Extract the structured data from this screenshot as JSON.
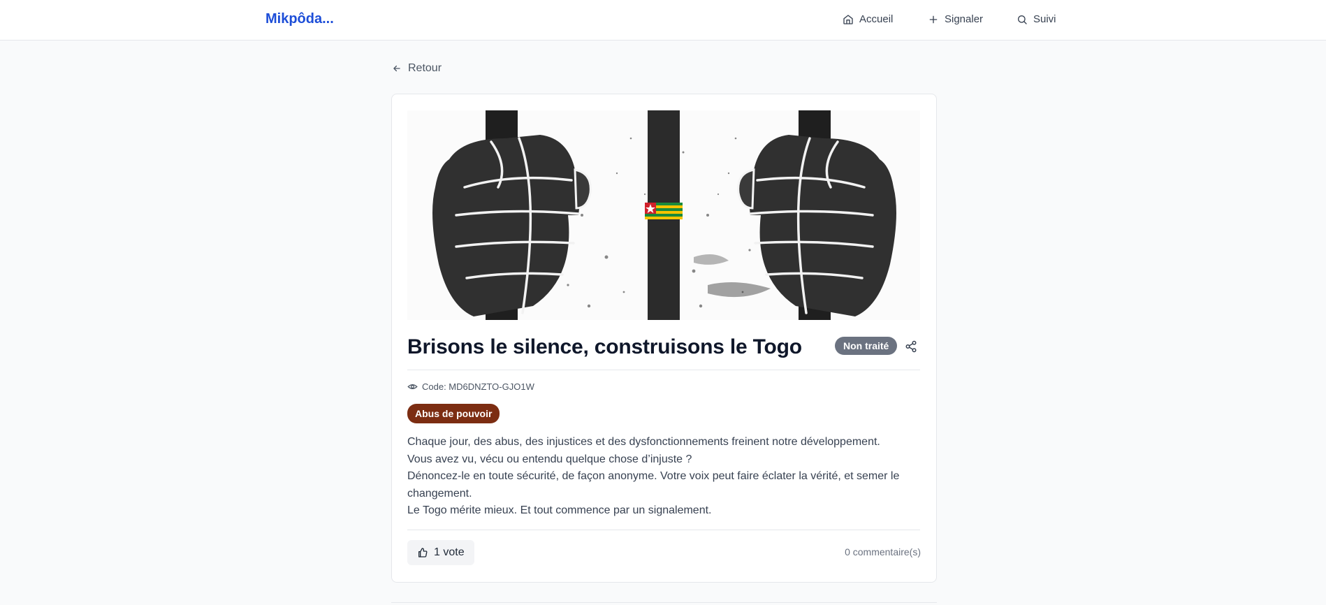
{
  "header": {
    "brand": "Mikpôda...",
    "nav": [
      {
        "label": "Accueil",
        "icon": "home-icon"
      },
      {
        "label": "Signaler",
        "icon": "plus-icon"
      },
      {
        "label": "Suivi",
        "icon": "search-icon"
      }
    ]
  },
  "back_label": "Retour",
  "report": {
    "image_alt": "Poings serrés sur des barreaux avec un drapeau du Togo",
    "title": "Brisons le silence, construisons le Togo",
    "status": "Non traité",
    "code": "Code: MD6DNZTO-GJO1W",
    "category": "Abus de pouvoir",
    "description": [
      "Chaque jour, des abus, des injustices et des dysfonctionnements freinent notre développement.",
      "Vous avez vu, vécu ou entendu quelque chose d’injuste ?",
      "Dénoncez-le en toute sécurité, de façon anonyme. Votre voix peut faire éclater la vérité, et semer le changement.",
      "Le Togo mérite mieux. Et tout commence par un signalement."
    ],
    "votes": "1 vote",
    "comments": "0 commentaire(s)"
  },
  "colors": {
    "brand": "#1d4ed8",
    "status_badge": "#6b7280",
    "category_badge": "#7c2d12",
    "flag_green": "#1a8a3c",
    "flag_yellow": "#f5c400",
    "flag_red": "#d0202a"
  }
}
